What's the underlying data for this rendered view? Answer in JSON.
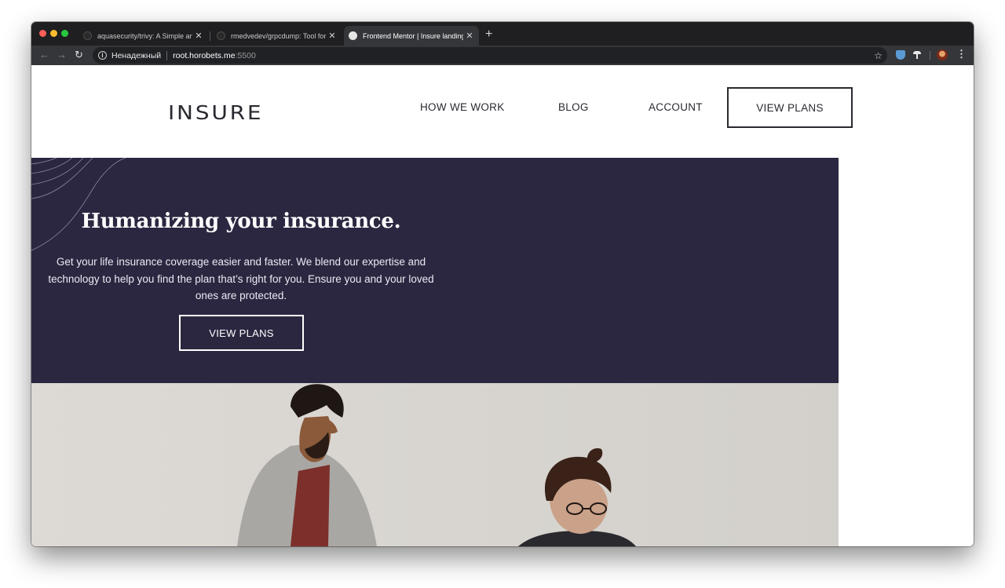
{
  "browser": {
    "tabs": [
      {
        "title": "aquasecurity/trivy: A Simple and",
        "close": "✕"
      },
      {
        "title": "rmedvedev/grpcdump: Tool for c",
        "close": "✕"
      },
      {
        "title": "Frontend Mentor | Insure landing",
        "close": "✕"
      }
    ],
    "new_tab": "+",
    "security_label": "Ненадежный",
    "url_host": "root.horobets.me",
    "url_port": ":5500",
    "icons": [
      "back-icon",
      "forward-icon",
      "reload-icon",
      "info-icon",
      "star-icon",
      "shield-extension-icon",
      "mushroom-extension-icon",
      "profile-avatar-icon",
      "menu-icon"
    ]
  },
  "site": {
    "logo": "INSURE",
    "nav": {
      "how": "HOW WE WORK",
      "blog": "BLOG",
      "account": "ACCOUNT",
      "cta": "VIEW PLANS"
    },
    "hero": {
      "title": "Humanizing your insurance.",
      "text": "Get your life insurance coverage easier and faster. We blend our expertise and technology to help you find the plan that’s right for you. Ensure you and your loved ones are protected.",
      "cta": "VIEW PLANS"
    },
    "colors": {
      "hero_bg": "#2c2740",
      "text_dark": "#2c2830",
      "white": "#ffffff"
    }
  }
}
